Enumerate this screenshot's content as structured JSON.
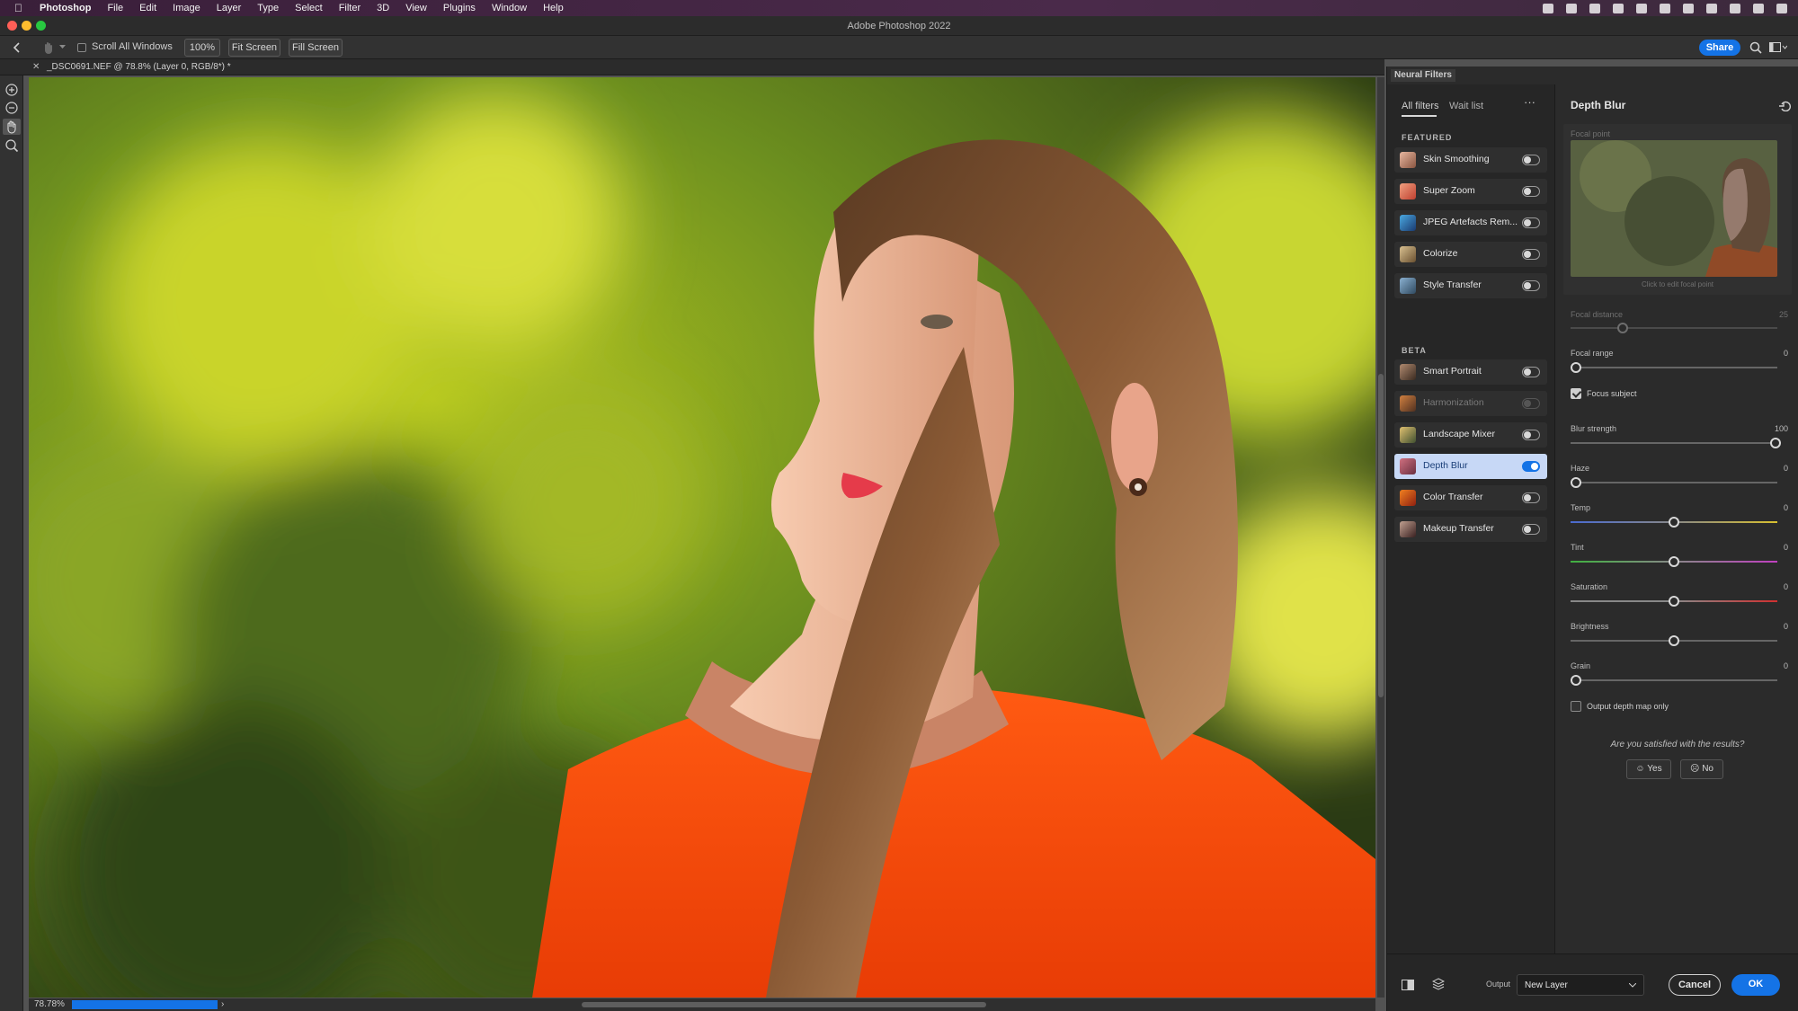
{
  "menubar": {
    "app_name": "Photoshop",
    "items": [
      "File",
      "Edit",
      "Image",
      "Layer",
      "Type",
      "Select",
      "Filter",
      "3D",
      "View",
      "Plugins",
      "Window",
      "Help"
    ]
  },
  "window": {
    "title": "Adobe Photoshop 2022"
  },
  "options": {
    "scroll_all_windows": "Scroll All Windows",
    "zoom_100": "100%",
    "fit_screen": "Fit Screen",
    "fill_screen": "Fill Screen",
    "share": "Share"
  },
  "document": {
    "tab_title": "_DSC0691.NEF @ 78.8% (Layer 0, RGB/8*) *",
    "zoom_status": "78.78%"
  },
  "neural_filters": {
    "panel_title": "Neural Filters",
    "tabs": {
      "all": "All filters",
      "waitlist": "Wait list"
    },
    "sections": {
      "featured": "FEATURED",
      "beta": "BETA"
    },
    "featured": [
      {
        "name": "Skin Smoothing",
        "enabled": false
      },
      {
        "name": "Super Zoom",
        "enabled": false
      },
      {
        "name": "JPEG Artefacts Rem...",
        "enabled": false
      },
      {
        "name": "Colorize",
        "enabled": false
      },
      {
        "name": "Style Transfer",
        "enabled": false
      }
    ],
    "beta": [
      {
        "name": "Smart Portrait",
        "enabled": false
      },
      {
        "name": "Harmonization",
        "enabled": false
      },
      {
        "name": "Landscape Mixer",
        "enabled": false
      },
      {
        "name": "Depth Blur",
        "enabled": true
      },
      {
        "name": "Color Transfer",
        "enabled": false
      },
      {
        "name": "Makeup Transfer",
        "enabled": false
      }
    ]
  },
  "depth_blur": {
    "title": "Depth Blur",
    "focal_point_label": "Focal point",
    "focal_point_hint": "Click to edit focal point",
    "focal_distance": {
      "label": "Focal distance",
      "value": "25"
    },
    "focal_range": {
      "label": "Focal range",
      "value": "0"
    },
    "focus_subject": {
      "label": "Focus subject",
      "checked": true
    },
    "blur_strength": {
      "label": "Blur strength",
      "value": "100"
    },
    "haze": {
      "label": "Haze",
      "value": "0"
    },
    "temp": {
      "label": "Temp",
      "value": "0"
    },
    "tint": {
      "label": "Tint",
      "value": "0"
    },
    "saturation": {
      "label": "Saturation",
      "value": "0"
    },
    "brightness": {
      "label": "Brightness",
      "value": "0"
    },
    "grain": {
      "label": "Grain",
      "value": "0"
    },
    "output_depth_map": {
      "label": "Output depth map only",
      "checked": false
    },
    "feedback_question": "Are you satisfied with the results?",
    "yes": "Yes",
    "no": "No"
  },
  "footer": {
    "output_label": "Output",
    "output_value": "New Layer",
    "cancel": "Cancel",
    "ok": "OK"
  },
  "colors": {
    "accent": "#1473e6",
    "active_row": "#c7d8f6"
  }
}
